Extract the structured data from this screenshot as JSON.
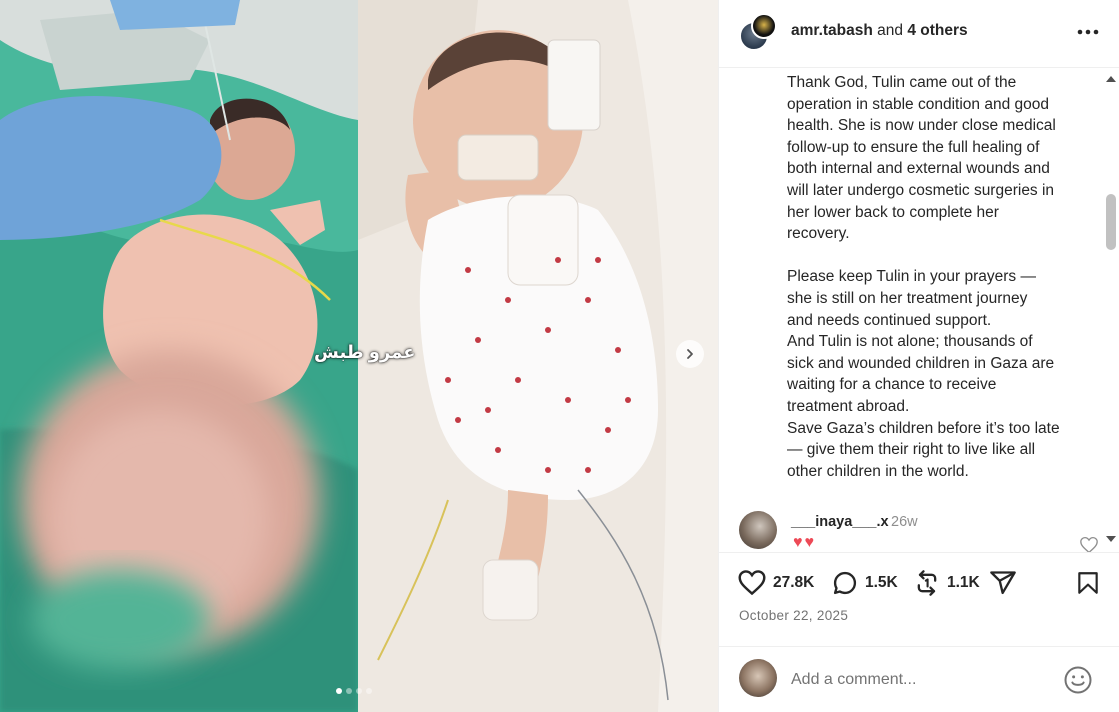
{
  "post": {
    "author": "amr.tabash",
    "and_text": " and ",
    "collaborators": "4 others",
    "watermark": "عمرو طبش",
    "carousel": {
      "count": 4,
      "active_index": 0
    }
  },
  "caption": {
    "paragraph1": "Thank God, Tulin came out of the\noperation in stable condition and good\nhealth. She is now under close medical\nfollow-up to ensure the full healing of\nboth internal and external wounds and\nwill later undergo cosmetic surgeries in\nher lower back to complete her\nrecovery.",
    "paragraph2": "Please keep Tulin in your prayers —\nshe is still on her treatment journey\nand needs continued support.\nAnd Tulin is not alone; thousands of\nsick and wounded children in Gaza are\nwaiting for a chance to receive\ntreatment abroad.\nSave Gaza’s children before it’s too late\n— give them their right to live like all\nother children in the world."
  },
  "comment": {
    "user": "___inaya___.x",
    "time": "26w",
    "text": "♥♥"
  },
  "actions": {
    "likes": "27.8K",
    "comments": "1.5K",
    "reposts": "1.1K"
  },
  "date": "October 22, 2025",
  "add_comment": {
    "placeholder": "Add a comment..."
  },
  "colors": {
    "text": "#262626",
    "muted": "#737373",
    "border": "#efefef",
    "heart": "#ed4956",
    "surgical_green": "#3fae93"
  },
  "icons": [
    "more-options-icon",
    "heart-icon",
    "comment-icon",
    "repost-icon",
    "share-icon",
    "bookmark-icon",
    "emoji-icon",
    "chevron-right-icon"
  ]
}
